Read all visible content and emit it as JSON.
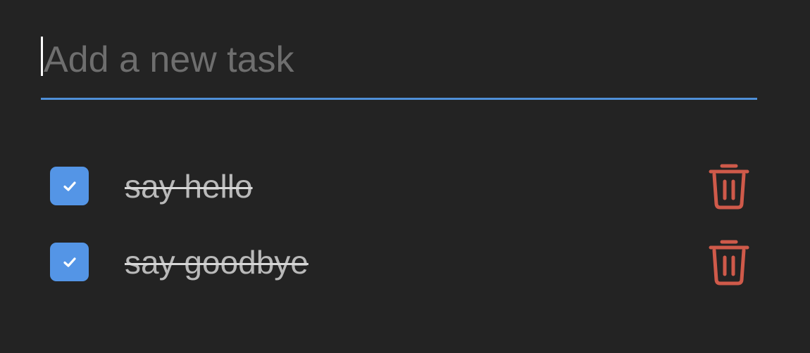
{
  "input": {
    "placeholder": "Add a new task",
    "value": ""
  },
  "tasks": [
    {
      "label": "say hello",
      "completed": true
    },
    {
      "label": "say goodbye",
      "completed": true
    }
  ],
  "icons": {
    "checkbox_checked": "check-icon",
    "delete": "trash-icon"
  },
  "colors": {
    "background": "#232323",
    "accent": "#4f8fd8",
    "checkbox": "#5495e6",
    "delete": "#cf5a4a",
    "completed_text": "#b9b9b9",
    "placeholder": "#6e6e6e"
  }
}
